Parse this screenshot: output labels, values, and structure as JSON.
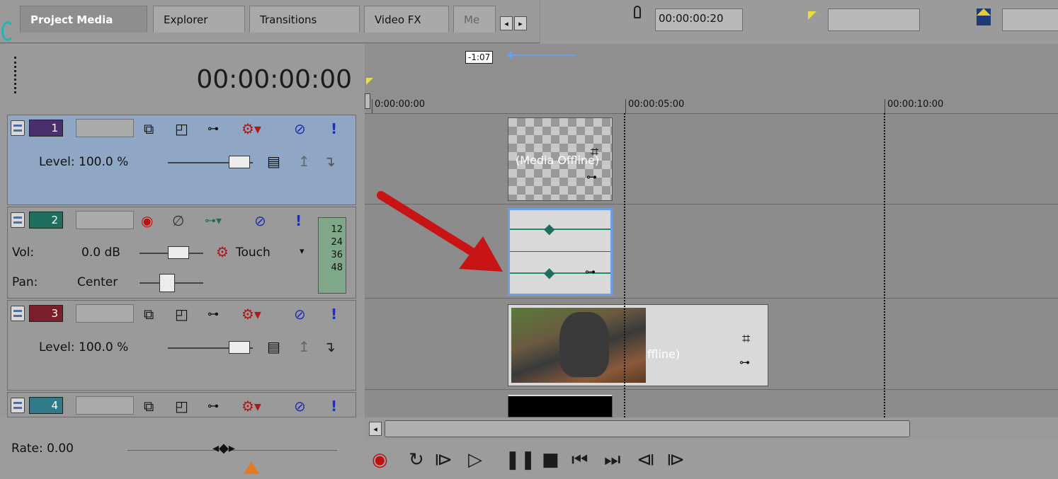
{
  "tabs": {
    "items": [
      {
        "label": "Project Media"
      },
      {
        "label": "Explorer"
      },
      {
        "label": "Transitions"
      },
      {
        "label": "Video FX"
      },
      {
        "label": "Me"
      }
    ]
  },
  "toolbar": {
    "cursor_time": "00:00:00:20"
  },
  "left": {
    "timecode": "00:00:00:00",
    "rate_label": "Rate: 0.00"
  },
  "tracks": [
    {
      "number": "1",
      "color": "#4a2f6e",
      "type": "video",
      "level_label": "Level: 100.0 %",
      "selected": true
    },
    {
      "number": "2",
      "color": "#1f6f5f",
      "type": "audio",
      "vol_label": "Vol:",
      "vol_value": "0.0 dB",
      "automation": "Touch",
      "pan_label": "Pan:",
      "pan_value": "Center",
      "meter": [
        "12",
        "24",
        "36",
        "48"
      ]
    },
    {
      "number": "3",
      "color": "#7a1f2a",
      "type": "video",
      "level_label": "Level: 100.0 %"
    },
    {
      "number": "4",
      "color": "#2f7a86",
      "type": "video"
    }
  ],
  "ruler": {
    "marker": "-1:07",
    "ticks": [
      "0:00:00:00",
      "00:00:05:00",
      "00:00:10:00"
    ]
  },
  "clips": {
    "offline_label": "(Media Offline)",
    "offline_label_partial": "ffline)"
  },
  "colors": {
    "selected_track": "#8fa6c4",
    "arrow": "#c81414",
    "selection_blue": "#6aa0e8"
  }
}
